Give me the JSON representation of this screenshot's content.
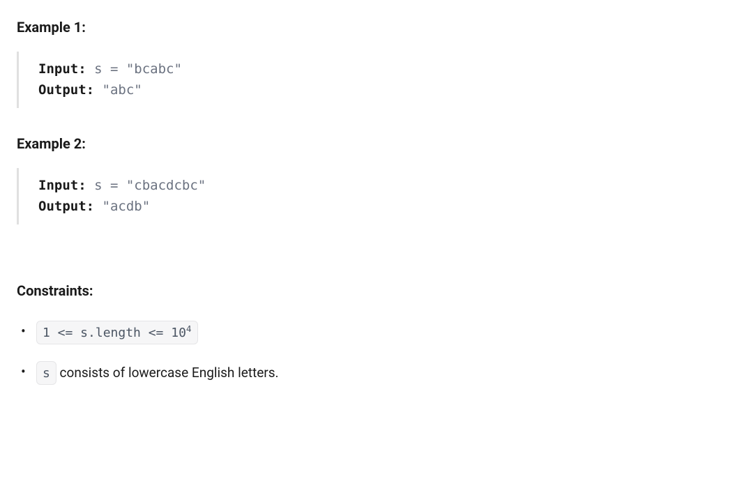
{
  "examples": [
    {
      "heading": "Example 1:",
      "input_label": "Input: ",
      "input_value": "s = \"bcabc\"",
      "output_label": "Output: ",
      "output_value": "\"abc\""
    },
    {
      "heading": "Example 2:",
      "input_label": "Input: ",
      "input_value": "s = \"cbacdcbc\"",
      "output_label": "Output: ",
      "output_value": "\"acdb\""
    }
  ],
  "constraints": {
    "heading": "Constraints:",
    "items": [
      {
        "code_prefix": "1 <= s.length <= 10",
        "code_sup": "4",
        "text": ""
      },
      {
        "code_prefix": "s",
        "code_sup": "",
        "text": " consists of lowercase English letters."
      }
    ]
  }
}
